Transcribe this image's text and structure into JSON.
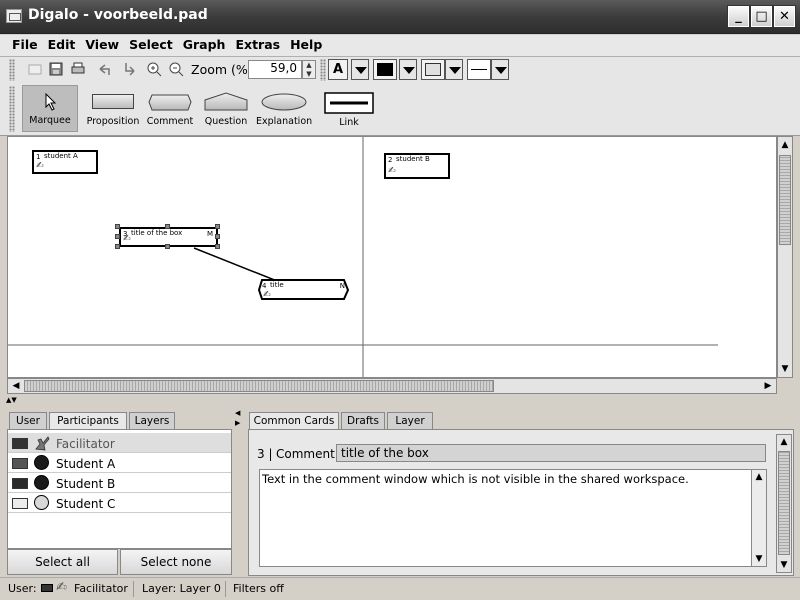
{
  "window": {
    "title": "Digalo - voorbeeld.pad",
    "buttons": {
      "minimize": "_",
      "maximize": "□",
      "close": "✕"
    }
  },
  "menu": [
    "File",
    "Edit",
    "View",
    "Select",
    "Graph",
    "Extras",
    "Help"
  ],
  "toolbar": {
    "zoom_label": "Zoom (%)",
    "zoom_value": "59,0",
    "font_button": "A",
    "icons": [
      "new-icon",
      "save-icon",
      "print-icon",
      "undo-icon",
      "redo-icon",
      "zoom-in-icon",
      "zoom-out-icon"
    ]
  },
  "palette": {
    "items": [
      {
        "label": "Marquee",
        "active": true
      },
      {
        "label": "Proposition"
      },
      {
        "label": "Comment"
      },
      {
        "label": "Question"
      },
      {
        "label": "Explanation"
      },
      {
        "label": "Link"
      }
    ]
  },
  "canvas": {
    "nodes": [
      {
        "num": "1",
        "text": "student A"
      },
      {
        "num": "2",
        "text": "student B"
      },
      {
        "num": "3",
        "text": "title of the box",
        "flag": "M"
      },
      {
        "num": "4",
        "text": "title",
        "flag": "N"
      }
    ]
  },
  "left_panel": {
    "tabs": [
      "User",
      "Participants",
      "Layers"
    ],
    "selected_tab": "Participants",
    "participants": [
      {
        "name": "Facilitator",
        "color": "#333333",
        "avatar": "hand-icon"
      },
      {
        "name": "Student A",
        "color": "#555555",
        "avatar": "#1a1a1a"
      },
      {
        "name": "Student B",
        "color": "#2a2a2a",
        "avatar": "#1a1a1a"
      },
      {
        "name": "Student C",
        "color": "#ebebeb",
        "avatar": "#d8d8d8"
      }
    ],
    "buttons": {
      "select_all": "Select all",
      "select_none": "Select none"
    }
  },
  "right_panel": {
    "tabs": [
      "Common Cards",
      "Drafts",
      "Layer"
    ],
    "selected_tab": "Common Cards",
    "card_number": "3 |",
    "card_type": "Comment",
    "card_title": "title of the box",
    "card_body": "Text in the comment window which is not visible in the shared workspace."
  },
  "status": {
    "user_label": "User:",
    "user_name": "Facilitator",
    "layer": "Layer: Layer 0",
    "filters": "Filters off"
  }
}
